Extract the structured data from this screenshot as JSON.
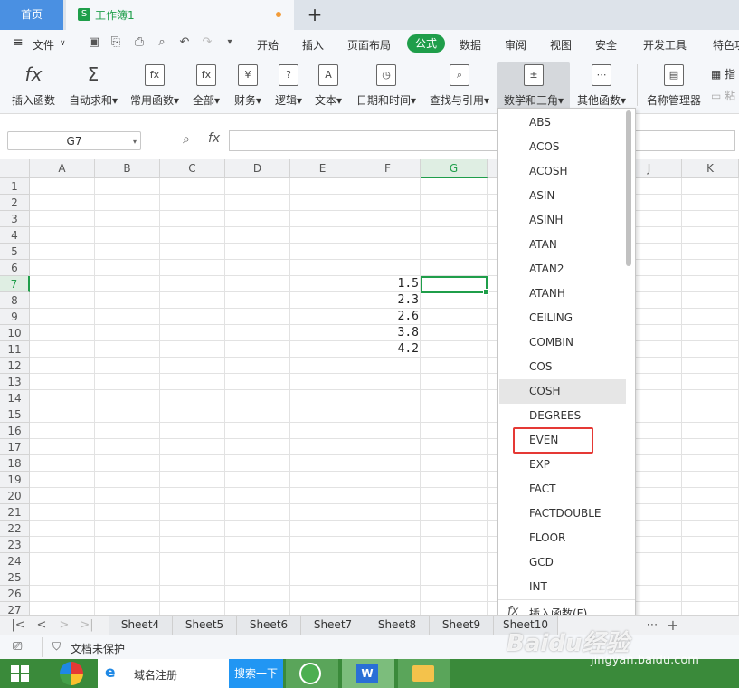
{
  "tabs": {
    "home": "首页",
    "doc": "工作簿1",
    "doc_icon": "S"
  },
  "menu": [
    "文件",
    "开始",
    "插入",
    "页面布局",
    "公式",
    "数据",
    "审阅",
    "视图",
    "安全",
    "开发工具",
    "特色功"
  ],
  "ribbon": [
    {
      "label": "插入函数",
      "icon": "fx"
    },
    {
      "label": "自动求和▾",
      "icon": "Σ"
    },
    {
      "label": "常用函数▾",
      "icon": "fx"
    },
    {
      "label": "全部▾",
      "icon": "fx"
    },
    {
      "label": "财务▾",
      "icon": "¥"
    },
    {
      "label": "逻辑▾",
      "icon": "?"
    },
    {
      "label": "文本▾",
      "icon": "A"
    },
    {
      "label": "日期和时间▾",
      "icon": "◷"
    },
    {
      "label": "查找与引用▾",
      "icon": "⌕"
    },
    {
      "label": "数学和三角▾",
      "icon": "±"
    },
    {
      "label": "其他函数▾",
      "icon": "⋯"
    },
    {
      "label": "名称管理器",
      "icon": "▤"
    }
  ],
  "ribbon_extra": {
    "a": "指",
    "b": "粘"
  },
  "formula_bar": {
    "name_box": "G7",
    "fx": "fx",
    "value": ""
  },
  "columns": [
    "A",
    "B",
    "C",
    "D",
    "E",
    "F",
    "G",
    "H",
    "I",
    "J",
    "K"
  ],
  "rows": [
    "1",
    "2",
    "3",
    "4",
    "5",
    "6",
    "7",
    "8",
    "9",
    "10",
    "11",
    "12",
    "13",
    "14",
    "15",
    "16",
    "17",
    "18",
    "19",
    "20",
    "21",
    "22",
    "23",
    "24",
    "25",
    "26",
    "27"
  ],
  "cells": {
    "F7": "1.5",
    "F8": "2.3",
    "F9": "2.6",
    "F10": "3.8",
    "F11": "4.2"
  },
  "active_cell": "G7",
  "sheets": [
    "Sheet4",
    "Sheet5",
    "Sheet6",
    "Sheet7",
    "Sheet8",
    "Sheet9",
    "Sheet10"
  ],
  "status": {
    "protect": "文档未保护"
  },
  "dropdown": {
    "items": [
      "ABS",
      "ACOS",
      "ACOSH",
      "ASIN",
      "ASINH",
      "ATAN",
      "ATAN2",
      "ATANH",
      "CEILING",
      "COMBIN",
      "COS",
      "COSH",
      "DEGREES",
      "EVEN",
      "EXP",
      "FACT",
      "FACTDOUBLE",
      "FLOOR",
      "GCD",
      "INT"
    ],
    "hover": "COSH",
    "highlighted": "EVEN",
    "footer": "插入函数(F)...",
    "footer_icon": "fx"
  },
  "taskbar": {
    "search_label": "域名注册",
    "search_button": "搜索一下"
  },
  "watermark": {
    "brand": "Baidu经验",
    "url": "jingyan.baidu.com"
  },
  "colors": {
    "accent_green": "#1f9e4a",
    "tab_blue": "#4a90e2",
    "highlight_red": "#e53935"
  }
}
